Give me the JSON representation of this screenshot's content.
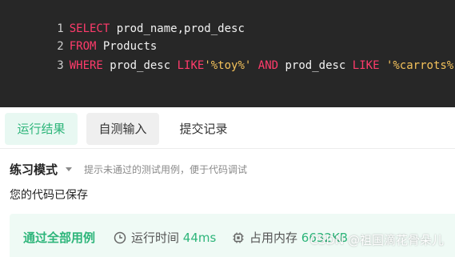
{
  "editor": {
    "lines": [
      {
        "num": "1",
        "tokens": [
          {
            "t": "SELECT",
            "c": "kw"
          },
          {
            "t": " prod_name,prod_desc",
            "c": ""
          }
        ]
      },
      {
        "num": "2",
        "tokens": [
          {
            "t": "FROM",
            "c": "kw"
          },
          {
            "t": " Products",
            "c": ""
          }
        ]
      },
      {
        "num": "3",
        "tokens": [
          {
            "t": "WHERE",
            "c": "kw"
          },
          {
            "t": " prod_desc ",
            "c": ""
          },
          {
            "t": "LIKE",
            "c": "kw"
          },
          {
            "t": "'%toy%'",
            "c": "str"
          },
          {
            "t": " ",
            "c": ""
          },
          {
            "t": "AND",
            "c": "kw"
          },
          {
            "t": " prod_desc ",
            "c": ""
          },
          {
            "t": "LIKE",
            "c": "kw"
          },
          {
            "t": " ",
            "c": ""
          },
          {
            "t": "'%carrots%'",
            "c": "str"
          }
        ]
      }
    ],
    "colors": {
      "background": "#272727",
      "keyword": "#ff3b6b",
      "string": "#f4c25b",
      "text": "#f2f2f2"
    }
  },
  "tabs": [
    {
      "label": "运行结果",
      "state": "active"
    },
    {
      "label": "自测输入",
      "state": "boxed"
    },
    {
      "label": "提交记录",
      "state": "plain"
    }
  ],
  "mode": {
    "label": "练习模式",
    "hint": "提示未通过的测试用例，便于代码调试",
    "dropdown_icon": "caret-down-icon"
  },
  "saved_message": "您的代码已保存",
  "result": {
    "status": "通过全部用例",
    "runtime": {
      "icon": "clock-icon",
      "label": "运行时间",
      "value": "44ms"
    },
    "memory": {
      "icon": "chip-icon",
      "label": "占用内存",
      "value": "6632KB"
    },
    "accent": "#2db57a",
    "background": "#effaf5"
  },
  "watermark": "CSDN @祖国滴花骨朵儿"
}
